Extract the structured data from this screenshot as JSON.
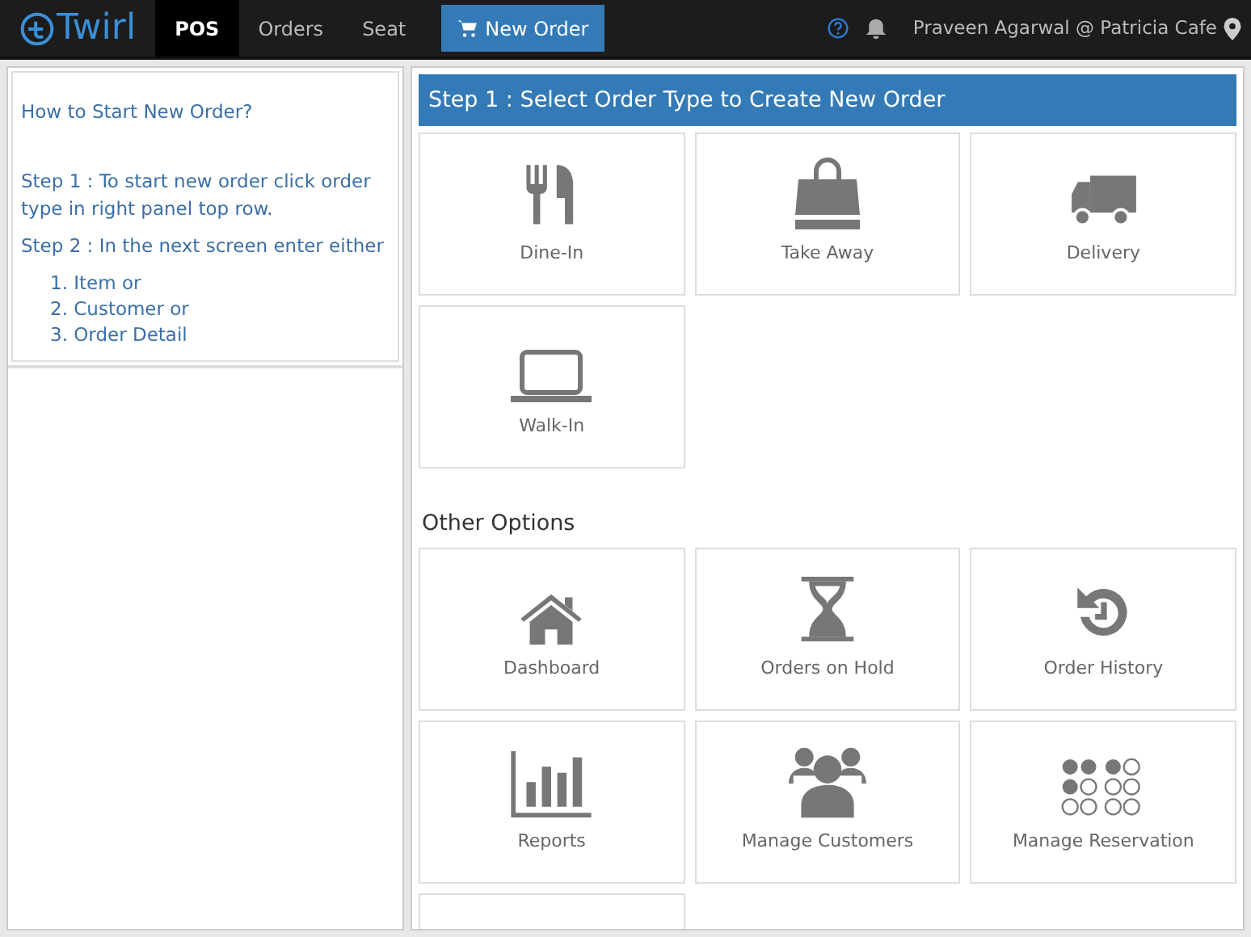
{
  "navbar": {
    "logo": "Twirl",
    "tabs": [
      {
        "label": "POS",
        "selected": true
      },
      {
        "label": "Orders",
        "selected": false
      },
      {
        "label": "Seat",
        "selected": false
      }
    ],
    "new_order_button": "New Order",
    "user": "Praveen Agarwal @ Patricia Cafe"
  },
  "help_panel": {
    "title": "How to Start New Order?",
    "steps": [
      "Step 1 : To start new order click order type in right panel top row.",
      "Step 2 : In the next screen enter either"
    ],
    "list": [
      "1. Item or",
      "2. Customer or",
      "3. Order Detail"
    ]
  },
  "order_panel": {
    "header": "Step 1 : Select Order Type to Create New Order",
    "order_types": [
      {
        "kind": "dine-in",
        "label": "Dine-In"
      },
      {
        "kind": "take-away",
        "label": "Take Away"
      },
      {
        "kind": "delivery",
        "label": "Delivery"
      },
      {
        "kind": "walk-in",
        "label": "Walk-In"
      }
    ],
    "other_options_title": "Other Options",
    "other_options": [
      {
        "kind": "dashboard",
        "label": "Dashboard"
      },
      {
        "kind": "hold",
        "label": "Orders on Hold"
      },
      {
        "kind": "history",
        "label": "Order History"
      },
      {
        "kind": "reports",
        "label": "Reports"
      },
      {
        "kind": "customers",
        "label": "Manage Customers"
      },
      {
        "kind": "reservation",
        "label": "Manage Reservation"
      }
    ]
  }
}
